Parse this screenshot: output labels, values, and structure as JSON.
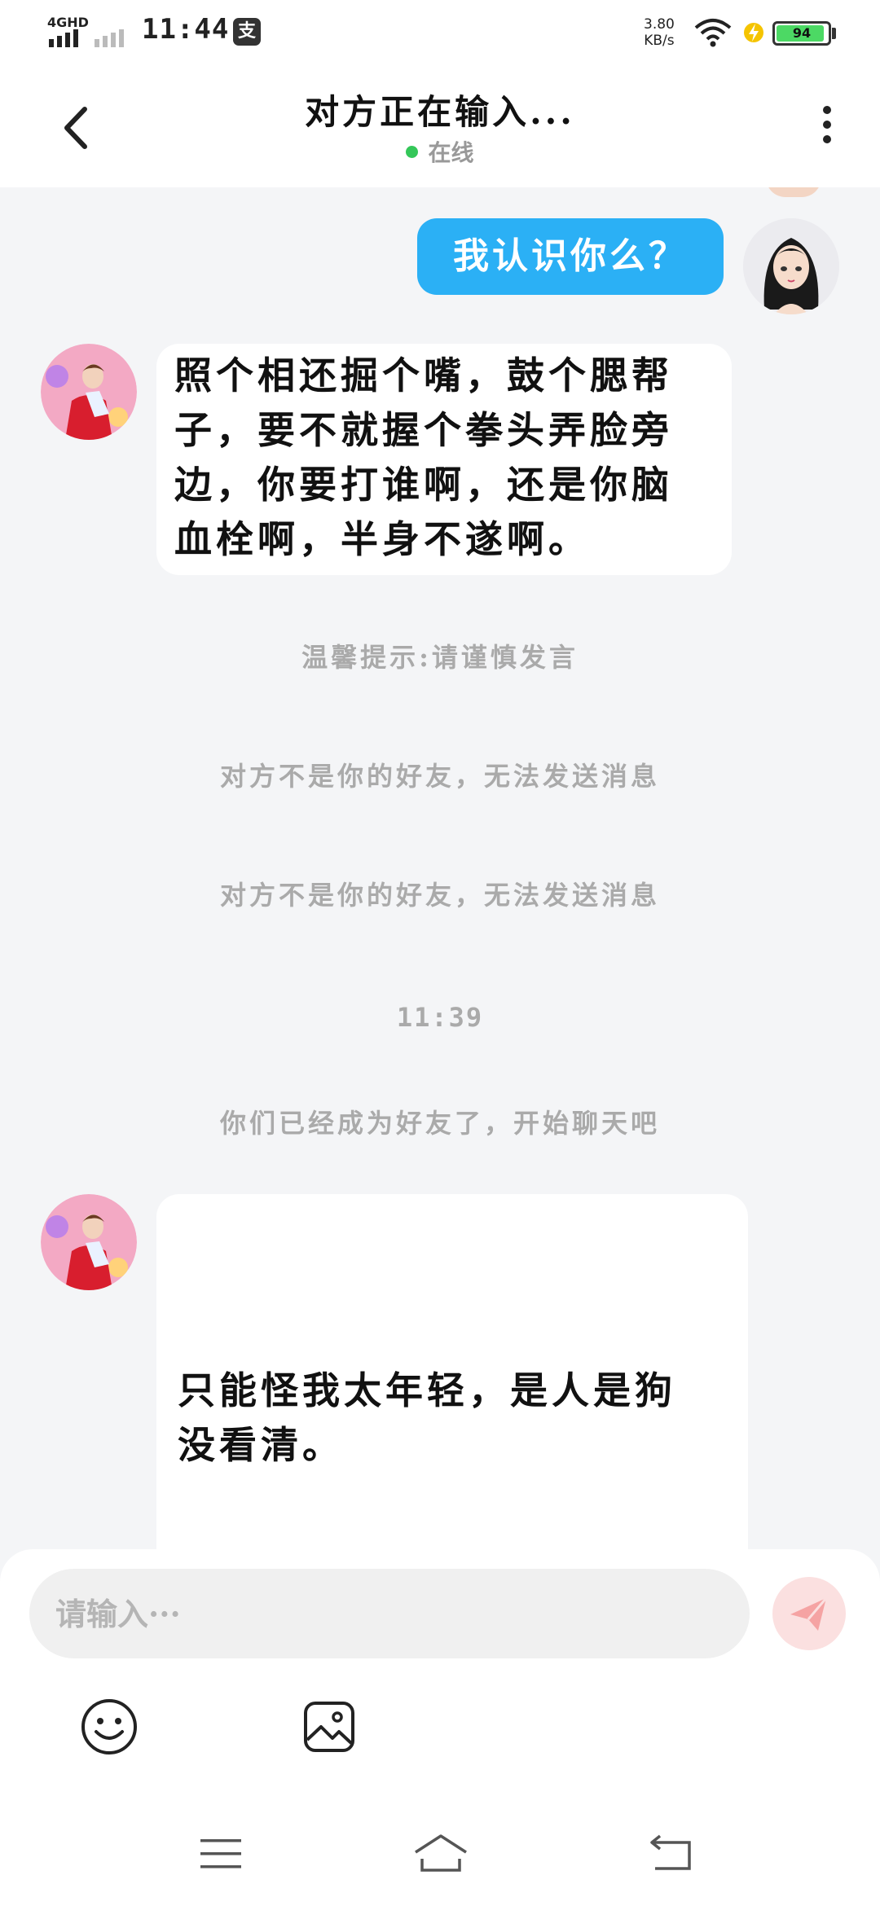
{
  "status_bar": {
    "network": "4GHD",
    "time": "11:44",
    "app_badge": "支",
    "speed_value": "3.80",
    "speed_unit": "KB/s",
    "battery": "94",
    "battery_level": 0.94,
    "battery_color": "#4cd964"
  },
  "header": {
    "title": "对方正在输入...",
    "status": "在线",
    "status_color": "#34c759",
    "back_icon": "chevron-left-icon",
    "more_icon": "more-vertical-icon"
  },
  "messages": [
    {
      "type": "outgoing",
      "text": "我认识你么？",
      "bubble_color": "#2bb0f5"
    },
    {
      "type": "incoming",
      "lines": [
        "照个相还掘个嘴，鼓个腮帮",
        "子，要不就握个拳头弄脸旁",
        "边，你要打谁啊，还是你脑",
        "血栓啊，半身不遂啊。"
      ]
    },
    {
      "type": "system",
      "text": "温馨提示:请谨慎发言"
    },
    {
      "type": "system",
      "text": "对方不是你的好友，无法发送消息"
    },
    {
      "type": "system",
      "text": "对方不是你的好友，无法发送消息"
    },
    {
      "type": "timestamp",
      "text": "11:39"
    },
    {
      "type": "system",
      "text": "你们已经成为好友了，开始聊天吧"
    },
    {
      "type": "incoming",
      "lines": [
        "只能怪我太年轻，是人是狗",
        "没看清。"
      ]
    }
  ],
  "input": {
    "placeholder": "请输入···",
    "send_icon": "send-icon",
    "emoji_icon": "emoji-icon",
    "image_icon": "image-icon"
  },
  "nav": {
    "menu_icon": "menu-icon",
    "home_icon": "home-icon",
    "back_icon": "back-icon"
  }
}
